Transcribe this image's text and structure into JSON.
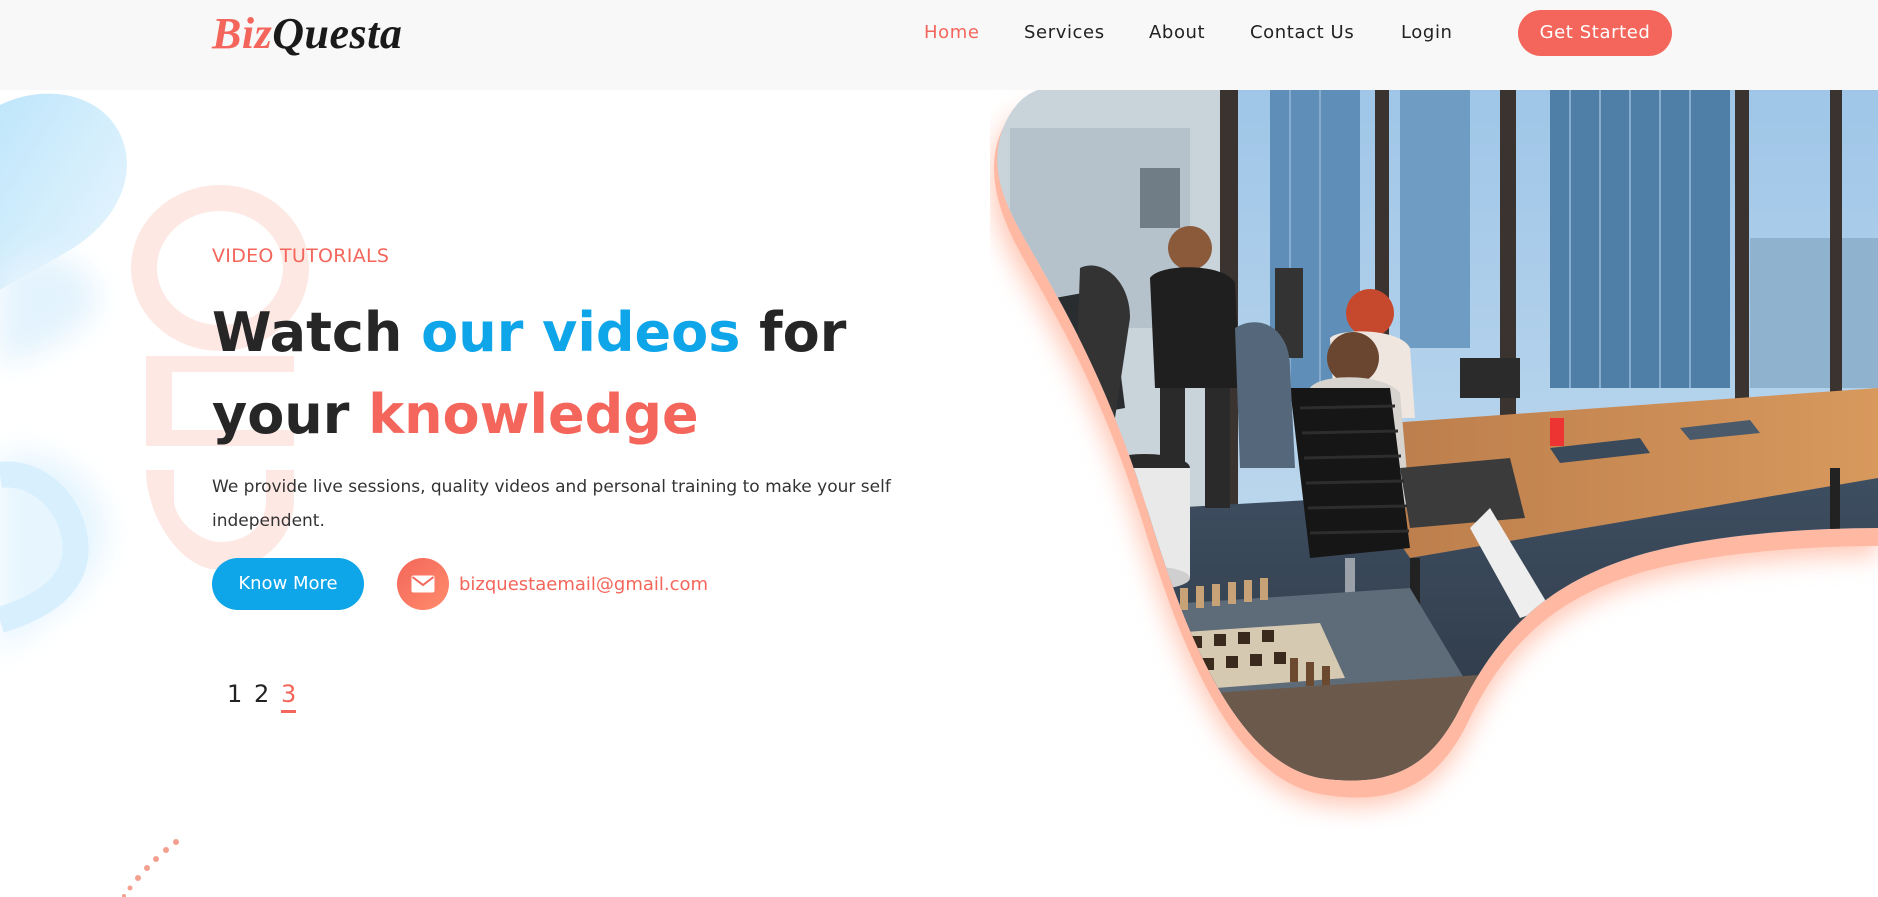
{
  "header": {
    "brand_part1": "Biz",
    "brand_part2": "Questa",
    "nav": [
      {
        "label": "Home",
        "active": true
      },
      {
        "label": "Services",
        "active": false
      },
      {
        "label": "About",
        "active": false
      },
      {
        "label": "Contact Us",
        "active": false
      },
      {
        "label": "Login",
        "active": false
      }
    ],
    "cta_label": "Get Started"
  },
  "hero": {
    "eyebrow": "VIDEO TUTORIALS",
    "headline_1": "Watch ",
    "headline_2": "our videos",
    "headline_3": " for",
    "headline_4": "your ",
    "headline_5": "knowledge",
    "description": "We provide live sessions, quality videos and personal training to make your self independent.",
    "button_label": "Know More",
    "email": "bizquestaemail@gmail.com",
    "slides": [
      "1",
      "2",
      "3"
    ],
    "active_slide": "3",
    "image_icon": "office-photo"
  },
  "colors": {
    "accent": "#f4665b",
    "primary": "#0ea5e9",
    "text": "#262626",
    "header_bg": "#f8f8f8"
  }
}
